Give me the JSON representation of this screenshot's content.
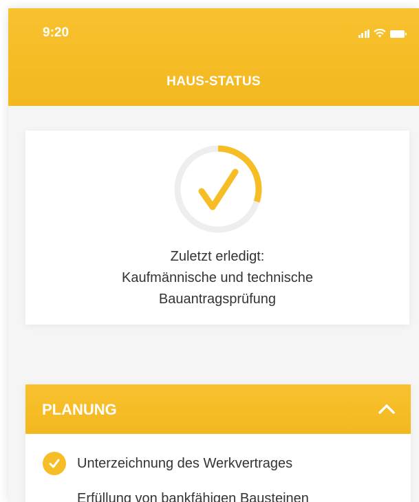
{
  "status_bar": {
    "time": "9:20"
  },
  "header": {
    "title": "HAUS-STATUS"
  },
  "status_card": {
    "progress": 0.3,
    "line1": "Zuletzt erledigt:",
    "line2": "Kaufmännische und technische",
    "line3": "Bauantragsprüfung"
  },
  "section": {
    "title": "PLANUNG",
    "tasks": [
      {
        "label": "Unterzeichnung des Werkvertrages"
      },
      {
        "label": "Erfüllung von bankfähigen Bausteinen"
      }
    ]
  },
  "colors": {
    "accent": "#f6bd27",
    "text": "#333333",
    "ring_track": "#eeeeee"
  },
  "icons": {
    "signal": "signal-icon",
    "wifi": "wifi-icon",
    "battery": "battery-icon",
    "check": "check-icon",
    "chevron": "chevron-up-icon"
  }
}
